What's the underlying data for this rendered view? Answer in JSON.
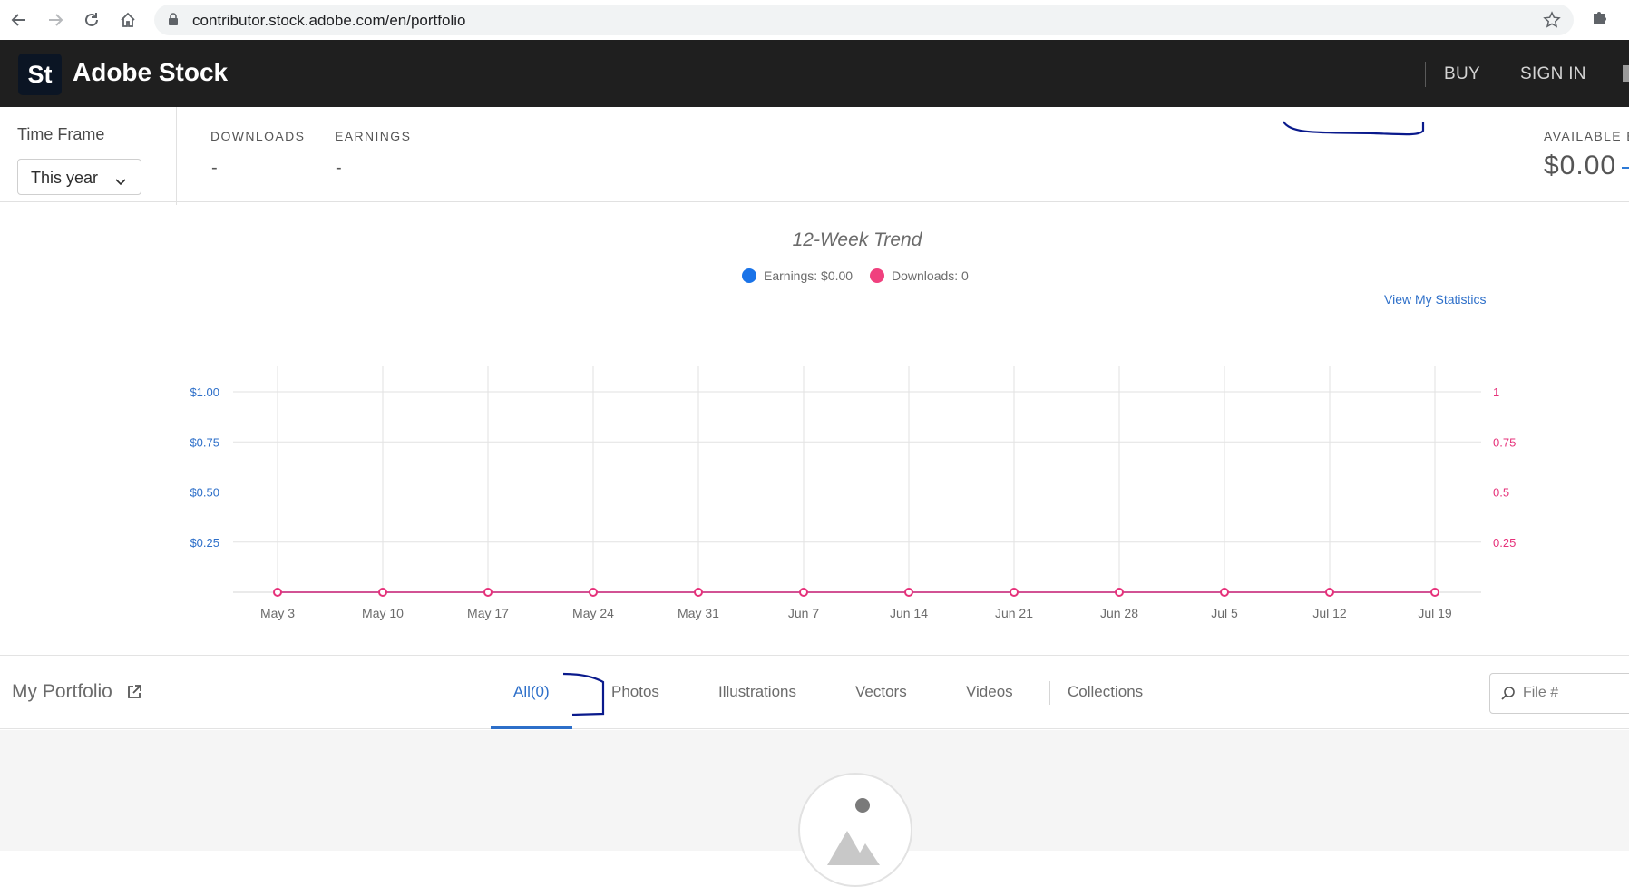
{
  "browser": {
    "url": "contributor.stock.adobe.com/en/portfolio"
  },
  "header": {
    "logo_mark": "St",
    "brand": "Adobe Stock",
    "buy_label": "BUY",
    "signin_label": "SIGN IN"
  },
  "stats": {
    "timeframe_label": "Time Frame",
    "timeframe_value": "This year",
    "downloads_label": "DOWNLOADS",
    "downloads_value": "-",
    "earnings_label": "EARNINGS",
    "earnings_value": "-",
    "available_label": "AVAILABLE E",
    "available_value": "$0.00"
  },
  "trend": {
    "title": "12-Week Trend",
    "legend_earnings": "Earnings: $0.00",
    "legend_downloads": "Downloads: 0",
    "view_stats_label": "View My Statistics"
  },
  "colors": {
    "earnings": "#2d6fc9",
    "downloads": "#e6317a",
    "legend_earnings_dot": "#1a73e8",
    "legend_downloads_dot": "#f0407e"
  },
  "chart_data": {
    "type": "line",
    "x": [
      "May 3",
      "May 10",
      "May 17",
      "May 24",
      "May 31",
      "Jun 7",
      "Jun 14",
      "Jun 21",
      "Jun 28",
      "Jul 5",
      "Jul 12",
      "Jul 19"
    ],
    "series": [
      {
        "name": "Earnings: $0.00",
        "values": [
          0,
          0,
          0,
          0,
          0,
          0,
          0,
          0,
          0,
          0,
          0,
          0
        ]
      },
      {
        "name": "Downloads: 0",
        "values": [
          0,
          0,
          0,
          0,
          0,
          0,
          0,
          0,
          0,
          0,
          0,
          0
        ]
      }
    ],
    "y_left_ticks": [
      "$0.25",
      "$0.50",
      "$0.75",
      "$1.00"
    ],
    "y_right_ticks": [
      "0.25",
      "0.5",
      "0.75",
      "1"
    ],
    "ylim": [
      0,
      1
    ],
    "grid": true
  },
  "portfolio": {
    "title": "My Portfolio",
    "tabs": [
      "All(0)",
      "Photos",
      "Illustrations",
      "Vectors",
      "Videos",
      "Collections"
    ],
    "search_placeholder": "File #"
  }
}
